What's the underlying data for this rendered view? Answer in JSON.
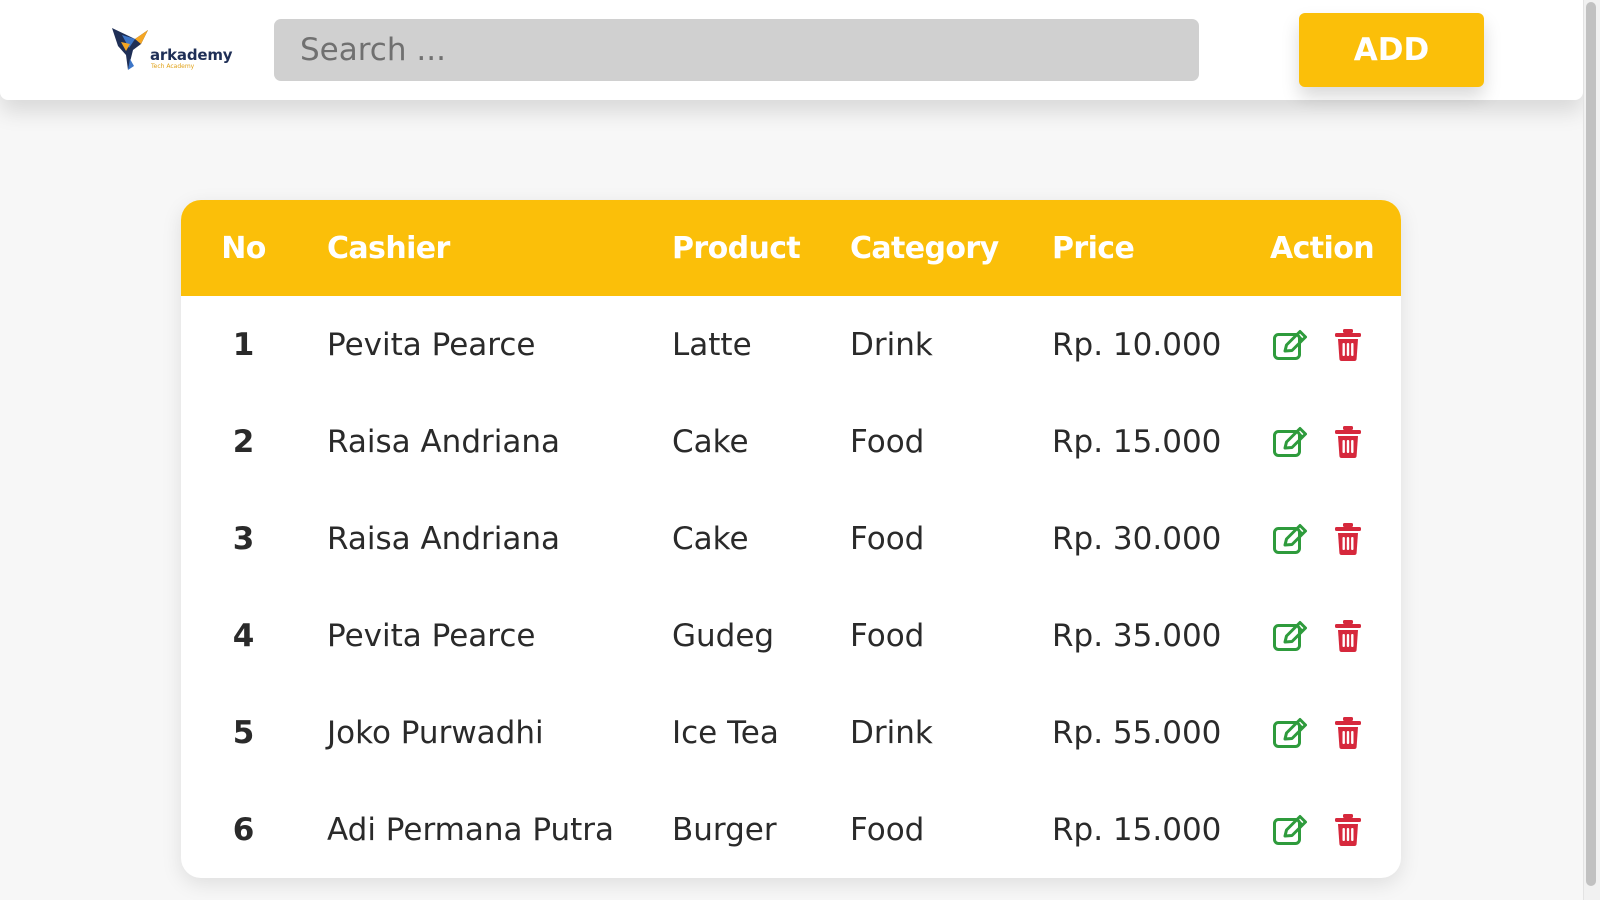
{
  "header": {
    "logo": {
      "text": "arkademy",
      "subtext": "Tech Academy",
      "bird_color": "#1f2f56",
      "accent_color": "#f5a623"
    },
    "search": {
      "placeholder": "Search ...",
      "value": ""
    },
    "add_label": "ADD"
  },
  "colors": {
    "primary": "#fbbf09",
    "edit": "#2e9b3c",
    "delete": "#d6283c"
  },
  "table": {
    "headers": [
      "No",
      "Cashier",
      "Product",
      "Category",
      "Price",
      "Action"
    ],
    "rows": [
      {
        "no": "1",
        "cashier": "Pevita Pearce",
        "product": "Latte",
        "category": "Drink",
        "price": "Rp. 10.000"
      },
      {
        "no": "2",
        "cashier": "Raisa Andriana",
        "product": "Cake",
        "category": "Food",
        "price": "Rp. 15.000"
      },
      {
        "no": "3",
        "cashier": "Raisa Andriana",
        "product": "Cake",
        "category": "Food",
        "price": "Rp. 30.000"
      },
      {
        "no": "4",
        "cashier": "Pevita Pearce",
        "product": "Gudeg",
        "category": "Food",
        "price": "Rp. 35.000"
      },
      {
        "no": "5",
        "cashier": "Joko Purwadhi",
        "product": "Ice Tea",
        "category": "Drink",
        "price": "Rp. 55.000"
      },
      {
        "no": "6",
        "cashier": "Adi Permana Putra",
        "product": "Burger",
        "category": "Food",
        "price": "Rp. 15.000"
      }
    ],
    "row_icons": {
      "edit": "edit-icon",
      "delete": "trash-icon"
    }
  }
}
